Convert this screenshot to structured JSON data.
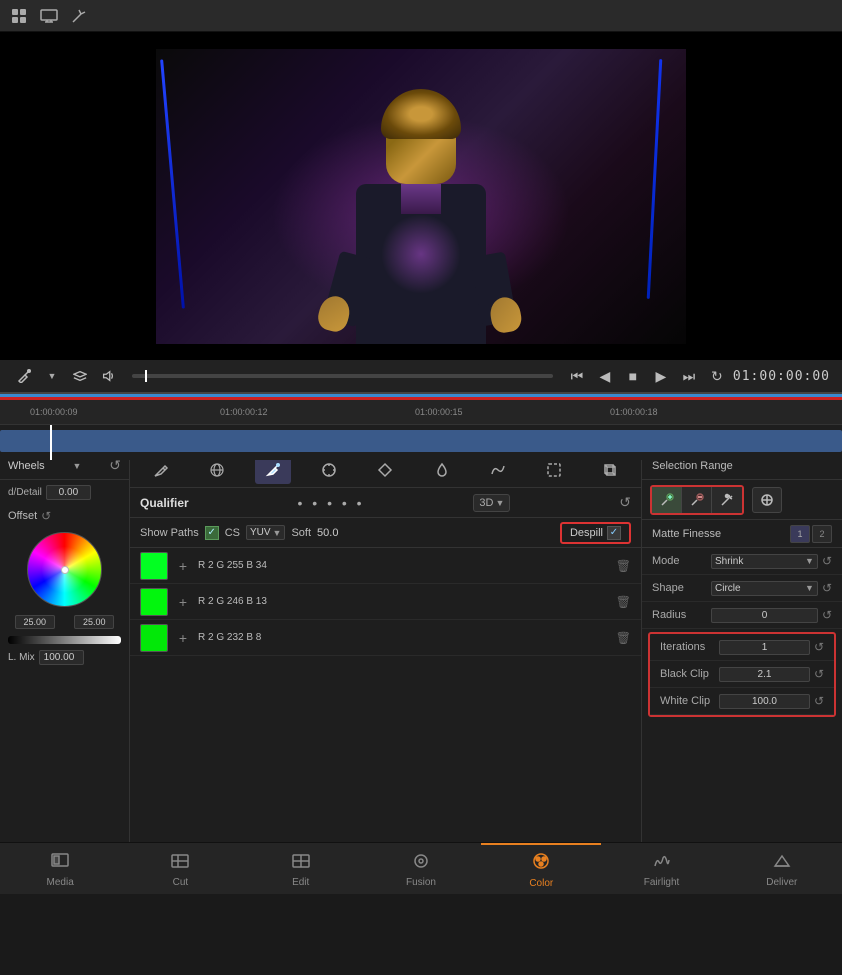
{
  "topToolbar": {
    "icons": [
      "grid-icon",
      "monitor-icon",
      "wand-icon"
    ]
  },
  "preview": {
    "timecode": "01:00:00:00"
  },
  "timeline": {
    "marks": [
      "01:00:00:09",
      "01:00:00:12",
      "01:00:00:15",
      "01:00:00:18"
    ]
  },
  "colorWheels": {
    "title": "Wheels",
    "detail_label": "d/Detail",
    "detail_value": "0.00",
    "offset_label": "Offset",
    "wheel_val1": "25.00",
    "wheel_val2": "25.00",
    "lmix_label": "L. Mix",
    "lmix_value": "100.00"
  },
  "qualifier": {
    "title": "Qualifier",
    "showPaths_label": "Show Paths",
    "cs_label": "CS",
    "cs_value": "YUV",
    "soft_label": "Soft",
    "soft_value": "50.0",
    "despill_label": "Despill",
    "threeD_label": "3D",
    "colors": [
      {
        "r": 2,
        "g": 255,
        "b": 34
      },
      {
        "r": 2,
        "g": 246,
        "b": 13
      },
      {
        "r": 2,
        "g": 232,
        "b": 8
      }
    ]
  },
  "selectionRange": {
    "title": "Selection Range"
  },
  "matteFinesse": {
    "title": "Matte Finesse",
    "tab1": "1",
    "tab2": "2",
    "mode_label": "Mode",
    "mode_value": "Shrink",
    "shape_label": "Shape",
    "shape_value": "Circle",
    "radius_label": "Radius",
    "radius_value": "0",
    "iterations_label": "Iterations",
    "iterations_value": "1",
    "blackClip_label": "Black Clip",
    "blackClip_value": "2.1",
    "whiteClip_label": "White Clip",
    "whiteClip_value": "100.0"
  },
  "bottomTabs": [
    {
      "id": "media",
      "label": "Media",
      "icon": "◫"
    },
    {
      "id": "cut",
      "label": "Cut",
      "icon": "⊞"
    },
    {
      "id": "edit",
      "label": "Edit",
      "icon": "⊟"
    },
    {
      "id": "fusion",
      "label": "Fusion",
      "icon": "◎"
    },
    {
      "id": "color",
      "label": "Color",
      "icon": "✦",
      "active": true
    },
    {
      "id": "fairlight",
      "label": "Fairlight",
      "icon": "♪"
    },
    {
      "id": "deliver",
      "label": "Deliver",
      "icon": "✈"
    }
  ]
}
